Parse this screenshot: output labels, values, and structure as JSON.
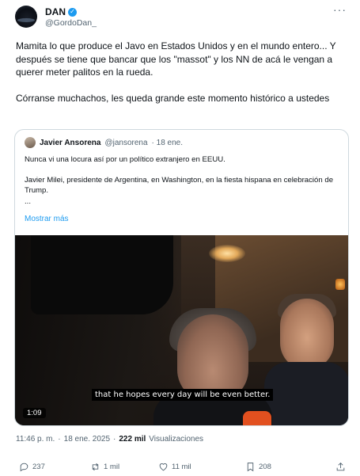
{
  "author": {
    "display_name": "DAN",
    "handle": "@GordoDan_",
    "verified_icon": "verified-badge-icon",
    "menu_label": "···"
  },
  "tweet": {
    "paragraph1": "Mamita lo que produce el Javo en Estados Unidos y en el mundo entero... Y después se tiene que bancar que los \"massot\" y los NN de acá le vengan a querer meter palitos en la rueda.",
    "paragraph2": "Córranse muchachos, les queda grande este momento histórico a ustedes"
  },
  "quote": {
    "name": "Javier Ansorena",
    "handle": "@jansorena",
    "date": "· 18 ene.",
    "line1": "Nunca vi una locura así por un político extranjero en EEUU.",
    "line2": "Javier Milei, presidente de Argentina, en Washington, en la fiesta hispana en celebración de Trump.",
    "line3": "...",
    "show_more": "Mostrar más"
  },
  "video": {
    "caption": "that he hopes every day will be even better.",
    "duration": "1:09"
  },
  "meta": {
    "time": "11:46 p. m.",
    "separator": "·",
    "date": "18 ene. 2025",
    "separator2": "·",
    "views": "222 mil",
    "views_label": "Visualizaciones"
  },
  "actions": {
    "replies": "237",
    "reposts": "1 mil",
    "likes": "11 mil",
    "bookmarks": "208"
  }
}
